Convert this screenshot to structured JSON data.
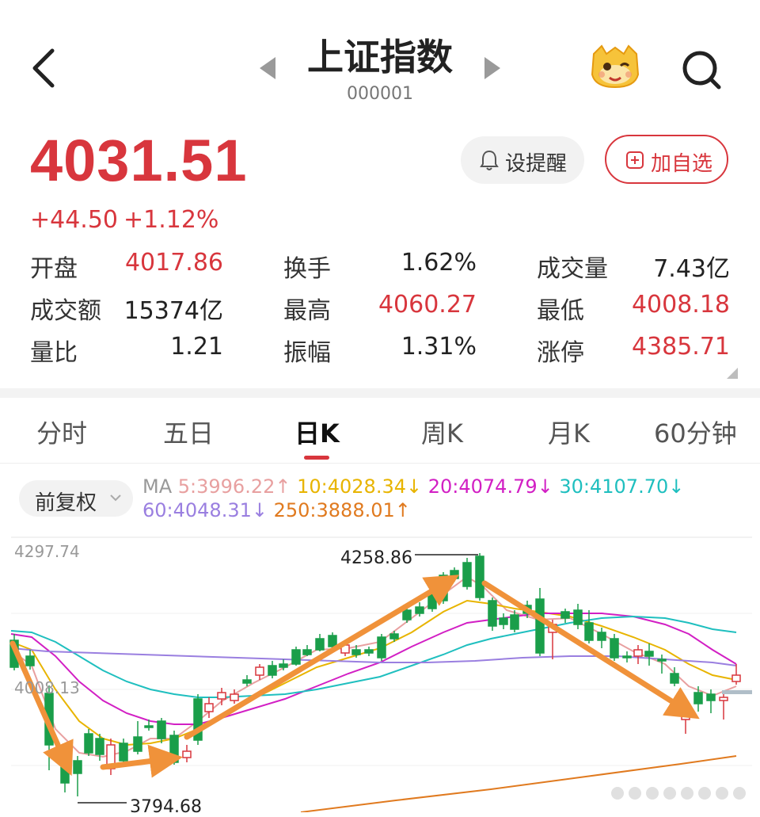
{
  "header": {
    "title": "上证指数",
    "code": "000001"
  },
  "quote": {
    "price": "4031.51",
    "change": "+44.50",
    "change_pct": "+1.12%"
  },
  "actions": {
    "alert_label": "设提醒",
    "favorite_label": "加自选"
  },
  "stats": [
    {
      "label": "开盘",
      "value": "4017.86",
      "tone": "red"
    },
    {
      "label": "换手",
      "value": "1.62%",
      "tone": "dark"
    },
    {
      "label": "成交量",
      "value": "7.43亿",
      "tone": "dark"
    },
    {
      "label": "成交额",
      "value": "15374亿",
      "tone": "dark"
    },
    {
      "label": "最高",
      "value": "4060.27",
      "tone": "red"
    },
    {
      "label": "最低",
      "value": "4008.18",
      "tone": "red"
    },
    {
      "label": "量比",
      "value": "1.21",
      "tone": "dark"
    },
    {
      "label": "振幅",
      "value": "1.31%",
      "tone": "dark"
    },
    {
      "label": "涨停",
      "value": "4385.71",
      "tone": "red"
    }
  ],
  "tabs": [
    {
      "label": "分时",
      "active": false
    },
    {
      "label": "五日",
      "active": false
    },
    {
      "label": "日K",
      "active": true
    },
    {
      "label": "周K",
      "active": false
    },
    {
      "label": "月K",
      "active": false
    },
    {
      "label": "60分钟",
      "active": false
    }
  ],
  "adjust": {
    "label": "前复权"
  },
  "ma": {
    "prefix": "MA",
    "items": [
      {
        "text": "5:3996.22↑",
        "color": "#e8a0a0"
      },
      {
        "text": "10:4028.34↓",
        "color": "#e8b400"
      },
      {
        "text": "20:4074.79↓",
        "color": "#d21fc4"
      },
      {
        "text": "30:4107.70↓",
        "color": "#1fbfbf"
      },
      {
        "text": "60:4048.31↓",
        "color": "#9a7fe0"
      },
      {
        "text": "250:3888.01↑",
        "color": "#e07a1f"
      }
    ]
  },
  "chart": {
    "axis_top": "4297.74",
    "axis_mid": "4008.13",
    "high_label": "4258.86",
    "low_label": "3794.68"
  },
  "colors": {
    "up": "#d8363d",
    "down": "#1a9e4a",
    "arrow": "#f0923a"
  },
  "icons": [
    "back-arrow-icon",
    "prev-triangle-icon",
    "next-triangle-icon",
    "mascot-icon",
    "search-icon",
    "bell-icon",
    "add-box-icon",
    "chevron-down-icon"
  ]
}
